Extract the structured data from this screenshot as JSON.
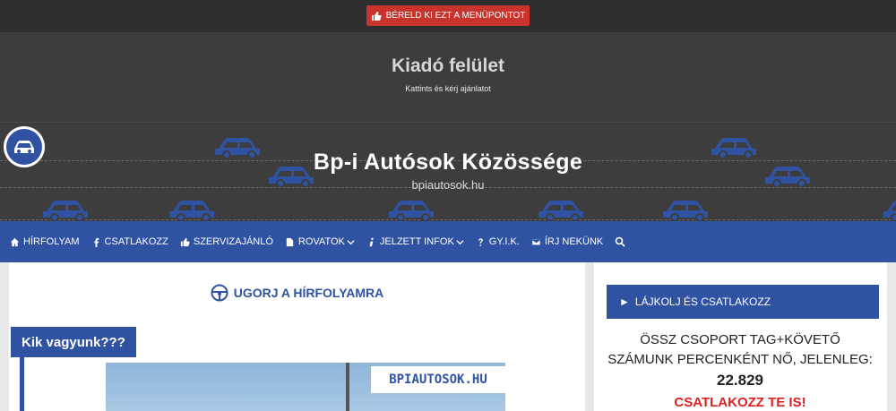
{
  "topbar": {
    "rent_button": "BÉRELD KI EZT A MENÜPONTOT",
    "icon": "thumbs-up-icon"
  },
  "ad": {
    "title": "Kiadó felület",
    "subtitle": "Kattints és kérj ajánlatot"
  },
  "header": {
    "title": "Bp-i Autósok Közössége",
    "subtitle": "bpiautosok.hu",
    "logo_icon": "car-logo-icon"
  },
  "nav": {
    "items": [
      {
        "label": "HÍRFOLYAM",
        "icon": "home-icon"
      },
      {
        "label": "CSATLAKOZZ",
        "icon": "facebook-icon"
      },
      {
        "label": "SZERVIZAJÁNLÓ",
        "icon": "thumbs-up-icon"
      },
      {
        "label": "ROVATOK",
        "icon": "document-icon",
        "dropdown": true
      },
      {
        "label": "JELZETT INFOK",
        "icon": "info-icon",
        "dropdown": true
      },
      {
        "label": "GY.I.K.",
        "icon": "question-icon"
      },
      {
        "label": "ÍRJ NEKÜNK",
        "icon": "envelope-icon"
      }
    ],
    "search_icon": "search-icon"
  },
  "main": {
    "jump_label": "UGORJ A HÍRFOLYAMRA",
    "who_heading": "Kik vagyunk???",
    "photo_badge": "BPIAUTOSOK.HU"
  },
  "sidebar": {
    "widget_title": "LÁJKOLJ ÉS CSATLAKOZZ",
    "text_line1": "ÖSSZ CSOPORT TAG+KÖVETŐ",
    "text_line2": "SZÁMUNK PERCENKÉNT NŐ, JELENLEG:",
    "count": "22.829",
    "join_text": "CSATLAKOZZ TE IS!"
  },
  "colors": {
    "brand_blue": "#2f53a2",
    "red": "#c8332b",
    "dark": "#3d3d3d",
    "join_red": "#e02020"
  }
}
